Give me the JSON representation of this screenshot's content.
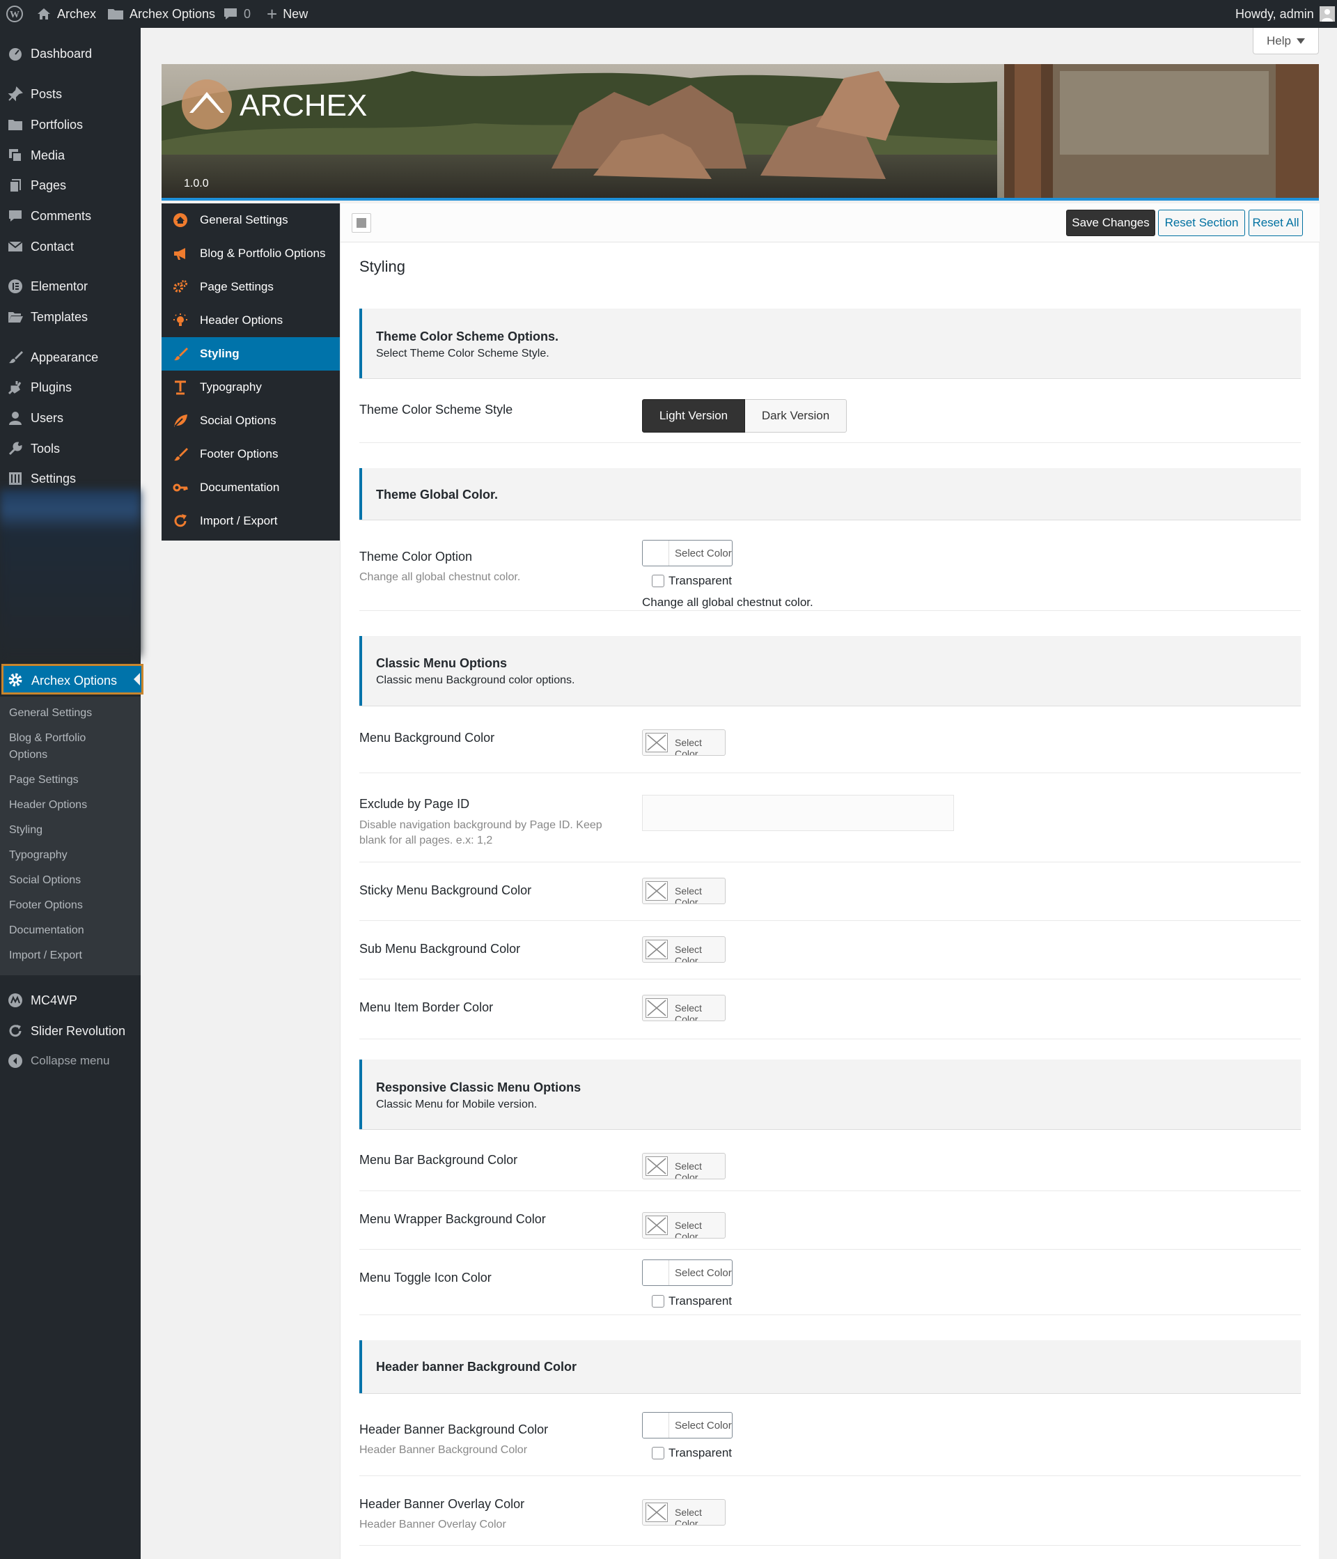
{
  "admin_bar": {
    "site_name": "Archex",
    "options_link": "Archex Options",
    "comments_count": "0",
    "new_label": "New",
    "greeting": "Howdy, admin"
  },
  "admin_menu": {
    "items": [
      {
        "label": "Dashboard",
        "icon": "dashboard-icon"
      },
      {
        "label": "Posts",
        "icon": "pin-icon"
      },
      {
        "label": "Portfolios",
        "icon": "folder-icon"
      },
      {
        "label": "Media",
        "icon": "media-icon"
      },
      {
        "label": "Pages",
        "icon": "pages-icon"
      },
      {
        "label": "Comments",
        "icon": "comment-icon"
      },
      {
        "label": "Contact",
        "icon": "mail-icon"
      },
      {
        "label": "Elementor",
        "icon": "elementor-icon"
      },
      {
        "label": "Templates",
        "icon": "folder-open-icon"
      },
      {
        "label": "Appearance",
        "icon": "brush-icon"
      },
      {
        "label": "Plugins",
        "icon": "plug-icon"
      },
      {
        "label": "Users",
        "icon": "user-icon"
      },
      {
        "label": "Tools",
        "icon": "wrench-icon"
      },
      {
        "label": "Settings",
        "icon": "settings-icon"
      }
    ],
    "active": {
      "label": "Archex Options",
      "icon": "gear-icon"
    },
    "submenu": [
      "General Settings",
      "Blog & Portfolio",
      "Options",
      "Page Settings",
      "Header Options",
      "Styling",
      "Typography",
      "Social Options",
      "Footer Options",
      "Documentation",
      "Import / Export"
    ],
    "bottom": [
      {
        "label": "MC4WP",
        "icon": "mc4wp-icon"
      },
      {
        "label": "Slider Revolution",
        "icon": "refresh-icon"
      },
      {
        "label": "Collapse menu",
        "icon": "collapse-icon"
      }
    ]
  },
  "help_label": "Help",
  "banner": {
    "logo_text": "ARCHEX",
    "version": "1.0.0"
  },
  "options_nav": [
    {
      "label": "General Settings",
      "icon": "home-icon"
    },
    {
      "label": "Blog & Portfolio Options",
      "icon": "megaphone-icon"
    },
    {
      "label": "Page Settings",
      "icon": "cogs-icon"
    },
    {
      "label": "Header Options",
      "icon": "bulb-icon"
    },
    {
      "label": "Styling",
      "icon": "brush-icon",
      "active": true
    },
    {
      "label": "Typography",
      "icon": "text-icon"
    },
    {
      "label": "Social Options",
      "icon": "leaf-icon"
    },
    {
      "label": "Footer Options",
      "icon": "brush-icon"
    },
    {
      "label": "Documentation",
      "icon": "key-icon"
    },
    {
      "label": "Import / Export",
      "icon": "refresh-icon"
    }
  ],
  "toolbar": {
    "save": "Save Changes",
    "reset_section": "Reset Section",
    "reset_all": "Reset All"
  },
  "page_title": "Styling",
  "sections": {
    "scheme": {
      "title": "Theme Color Scheme Options.",
      "desc": "Select Theme Color Scheme Style."
    },
    "scheme_row": {
      "label": "Theme Color Scheme Style",
      "options": [
        "Light Version",
        "Dark Version"
      ],
      "selected": "Light Version"
    },
    "global": {
      "title": "Theme Global Color."
    },
    "global_row": {
      "label": "Theme Color Option",
      "sub": "Change all global chestnut color.",
      "picker": "Select Color",
      "transparent": "Transparent",
      "note": "Change all global chestnut color."
    },
    "classic": {
      "title": "Classic Menu Options",
      "desc": "Classic menu Background color options."
    },
    "menu_bg": {
      "label": "Menu Background Color",
      "picker": "Select Color"
    },
    "exclude": {
      "label": "Exclude by Page ID",
      "sub1": "Disable navigation background by Page ID. Keep",
      "sub2": "blank for all pages. e.x: 1,2",
      "value": ""
    },
    "sticky": {
      "label": "Sticky Menu Background Color",
      "picker": "Select Color"
    },
    "submenu": {
      "label": "Sub Menu Background Color",
      "picker": "Select Color"
    },
    "border": {
      "label": "Menu Item Border Color",
      "picker": "Select Color"
    },
    "responsive": {
      "title": "Responsive Classic Menu Options",
      "desc": "Classic Menu for Mobile version."
    },
    "menubar": {
      "label": "Menu Bar Background Color",
      "picker": "Select Color"
    },
    "wrapper": {
      "label": "Menu Wrapper Background Color",
      "picker": "Select Color"
    },
    "toggle": {
      "label": "Menu Toggle Icon Color",
      "picker": "Select Color",
      "transparent": "Transparent"
    },
    "banner_head": {
      "title": "Header banner Background Color"
    },
    "banner_bg": {
      "label": "Header Banner Background Color",
      "sub": "Header Banner Background Color",
      "picker": "Select Color",
      "transparent": "Transparent"
    },
    "overlay": {
      "label": "Header Banner Overlay Color",
      "sub": "Header Banner Overlay Color",
      "picker": "Select Color"
    }
  },
  "colors": {
    "accent": "#0073aa",
    "admin_dark": "#23282d",
    "nav_icon": "#f07c2e"
  }
}
